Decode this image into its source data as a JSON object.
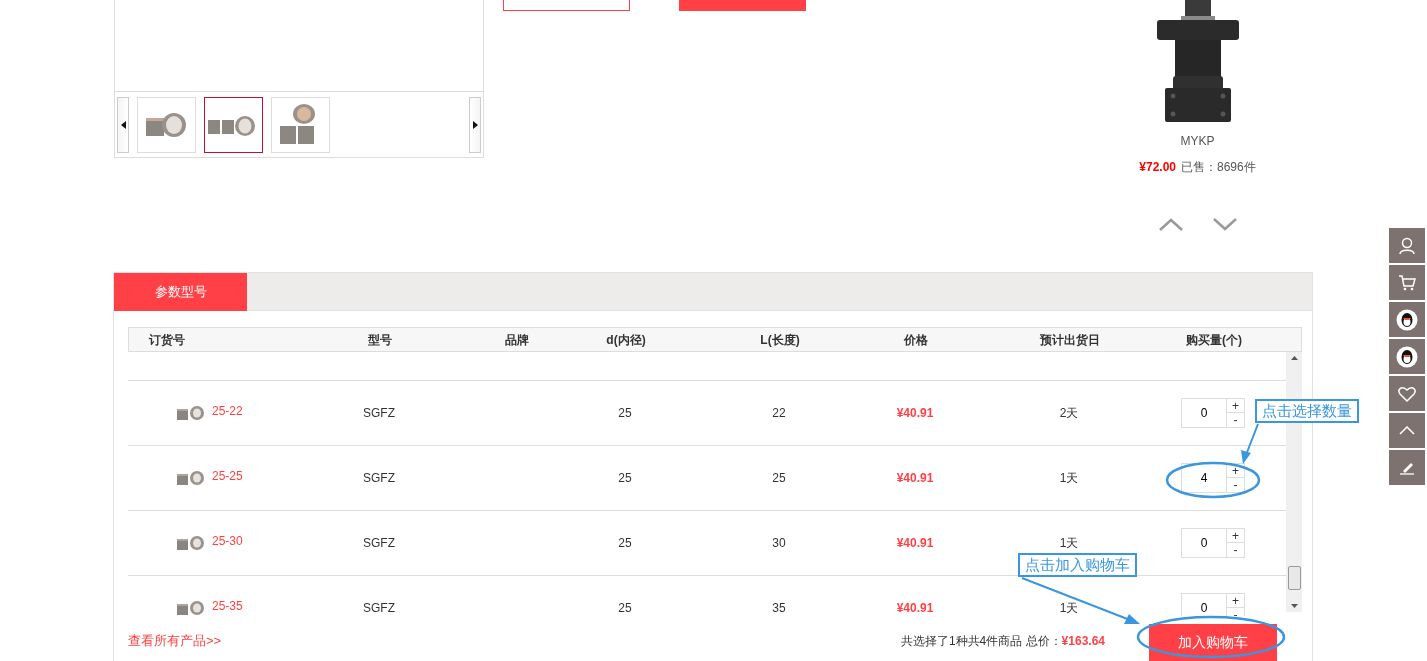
{
  "gallery": {
    "thumbnails": [
      {
        "selected": false
      },
      {
        "selected": true
      },
      {
        "selected": false
      }
    ]
  },
  "recommended": {
    "name": "MYKP",
    "price": "¥72.00",
    "sold": "已售：8696件"
  },
  "tabs": [
    {
      "label": "参数型号",
      "selected": true
    }
  ],
  "table": {
    "columns": [
      "订货号",
      "型号",
      "品牌",
      "d(内径)",
      "L(长度)",
      "价格",
      "预计出货日",
      "购买量(个)"
    ],
    "rows": [
      {
        "order_no": "25-22",
        "model": "SGFZ",
        "d": "25",
        "l": "22",
        "price": "¥40.91",
        "ship": "2天",
        "qty": "0"
      },
      {
        "order_no": "25-25",
        "model": "SGFZ",
        "d": "25",
        "l": "25",
        "price": "¥40.91",
        "ship": "1天",
        "qty": "4"
      },
      {
        "order_no": "25-30",
        "model": "SGFZ",
        "d": "25",
        "l": "30",
        "price": "¥40.91",
        "ship": "1天",
        "qty": "0"
      },
      {
        "order_no": "25-35",
        "model": "SGFZ",
        "d": "25",
        "l": "35",
        "price": "¥40.91",
        "ship": "1天",
        "qty": "0"
      }
    ],
    "stepper": {
      "plus": "+",
      "minus": "-"
    }
  },
  "footer": {
    "link": "查看所有产品>>",
    "summary": "共选择了1种共4件商品 总价：",
    "total": "¥163.64",
    "button": "加入购物车"
  },
  "annotations": [
    {
      "text": "点击选择数量"
    },
    {
      "text": "点击加入购物车"
    }
  ]
}
